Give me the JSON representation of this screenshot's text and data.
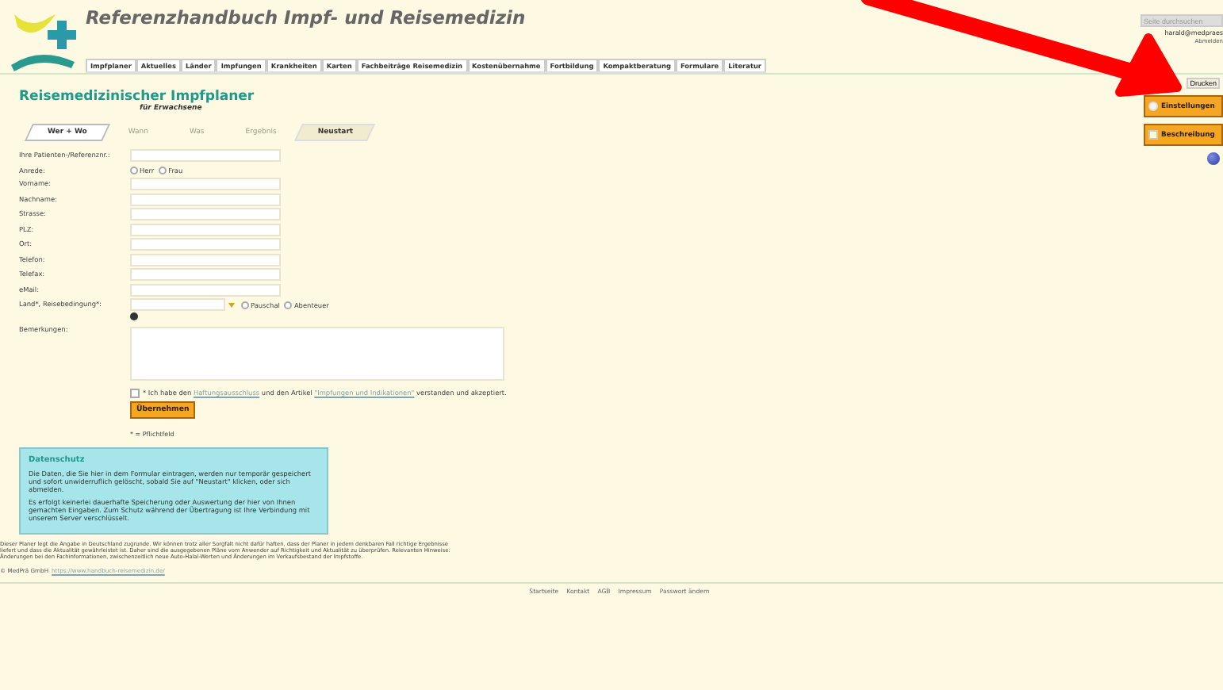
{
  "header": {
    "title": "Referenzhandbuch Impf- und Reisemedizin",
    "nav": [
      "Impfplaner",
      "Aktuelles",
      "Länder",
      "Impfungen",
      "Krankheiten",
      "Karten",
      "Fachbeiträge Reisemedizin",
      "Kostenübernahme",
      "Fortbildung",
      "Kompaktberatung",
      "Formulare",
      "Literatur"
    ],
    "search": {
      "placeholder": "Seite durchsuchen"
    },
    "user": "harald@medpraes",
    "logout": "Abmelden"
  },
  "print_button": "Drucken",
  "side_buttons": [
    {
      "kind": "gear",
      "label": "Einstellungen"
    },
    {
      "kind": "doc",
      "label": "Beschreibung"
    }
  ],
  "planner": {
    "title": "Reisemedizinischer Impfplaner",
    "subtitle": "für Erwachsene",
    "steps": [
      {
        "label": "Wer + Wo",
        "selected": true,
        "disabled": false
      },
      {
        "label": "Wann",
        "selected": false,
        "disabled": true
      },
      {
        "label": "Was",
        "selected": false,
        "disabled": true
      },
      {
        "label": "Ergebnis",
        "selected": false,
        "disabled": true
      },
      {
        "label": "Neustart",
        "selected": false,
        "disabled": false
      }
    ],
    "fields": [
      {
        "kind": "text",
        "label": "Ihre Patienten-/Referenznr.:"
      },
      {
        "kind": "radio",
        "label": "Anrede:",
        "options": [
          {
            "label": "Herr",
            "selected": false
          },
          {
            "label": "Frau",
            "selected": false
          }
        ]
      },
      {
        "kind": "text",
        "label": "Vorname:"
      },
      {
        "kind": "text",
        "label": "Nachname:"
      },
      {
        "kind": "text",
        "label": "Strasse:"
      },
      {
        "kind": "text",
        "label": "PLZ:"
      },
      {
        "kind": "text",
        "label": "Ort:"
      },
      {
        "kind": "text",
        "label": "Telefon:"
      },
      {
        "kind": "text",
        "label": "Telefax:"
      },
      {
        "kind": "text",
        "label": "eMail:"
      },
      {
        "kind": "country",
        "label": "Land*, Reisebedingung*:",
        "options": [
          {
            "label": "Pauschal",
            "selected": false
          },
          {
            "label": "Abenteuer",
            "selected": false
          }
        ]
      },
      {
        "kind": "textarea",
        "label": "Bemerkungen:"
      }
    ],
    "consent": {
      "checked": false,
      "before": "* Ich habe den ",
      "link1": "Haftungsausschluss",
      "middle": " und den Artikel ",
      "link2": "\"Impfungen und Indikationen\"",
      "after": " verstanden und akzeptiert."
    },
    "submit": "Übernehmen",
    "required_note": "* = Pflichtfeld"
  },
  "privacy": {
    "title": "Datenschutz",
    "paragraphs": [
      "Die Daten, die Sie hier in dem Formular eintragen, werden nur temporär gespeichert und sofort unwiderruflich gelöscht, sobald Sie auf \"Neustart\" klicken, oder sich abmelden.",
      "Es erfolgt keinerlei dauerhafte Speicherung oder Auswertung der hier von Ihnen gemachten Eingaben. Zum Schutz während der Übertragung ist Ihre Verbindung mit unserem Server verschlüsselt."
    ]
  },
  "disclaimer": "Dieser Planer legt die Angabe in Deutschland zugrunde. Wir können trotz aller Sorgfalt nicht dafür haften, dass der Planer in jedem denkbaren Fall richtige Ergebnisse liefert und dass die Aktualität gewährleistet ist. Daher sind die ausgegebenen Pläne vom Anwender auf Richtigkeit und Aktualität zu überprüfen. Relevanten Hinweise: Änderungen bei den Fachinformationen, zwischenzeitlich neue Auto-Halal-Werten und Änderungen im Verkaufsbestand der Impfstoffe.",
  "copyright": {
    "owner": "© MedPrä GmbH",
    "link": "https://www.handbuch-reisemedizin.de/"
  },
  "footer_links": [
    "Startseite",
    "Kontakt",
    "AGB",
    "Impressum",
    "Passwort ändern"
  ]
}
